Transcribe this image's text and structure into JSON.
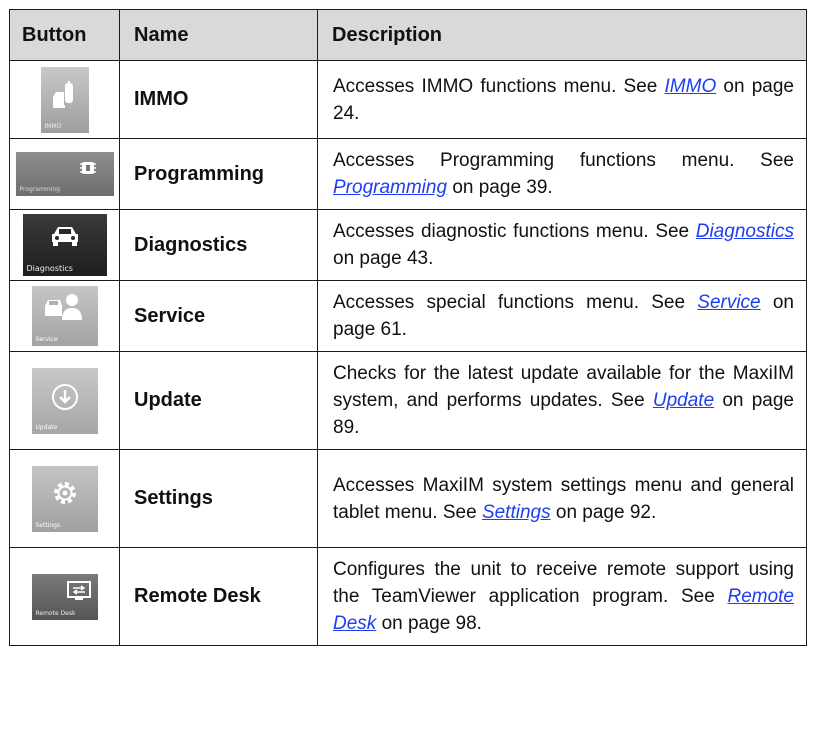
{
  "headers": {
    "button": "Button",
    "name": "Name",
    "description": "Description"
  },
  "rows": [
    {
      "name": "IMMO",
      "tile_caption": "IMMO",
      "icon": "car-key-fob-icon",
      "desc_pre": "Accesses IMMO functions menu. See ",
      "link": "IMMO",
      "desc_post": " on page 24."
    },
    {
      "name": "Programming",
      "tile_caption": "Programming",
      "icon": "chip-icon",
      "desc_pre": "Accesses Programming functions menu. See ",
      "link": "Programming",
      "desc_post": " on page 39."
    },
    {
      "name": "Diagnostics",
      "tile_caption": "Diagnostics",
      "icon": "car-front-icon",
      "desc_pre": "Accesses diagnostic functions menu. See ",
      "link": "Diagnostics",
      "desc_post": " on page 43."
    },
    {
      "name": "Service",
      "tile_caption": "Service",
      "icon": "car-mechanic-icon",
      "desc_pre": "Accesses special functions menu. See ",
      "link": "Service",
      "desc_post": " on page 61."
    },
    {
      "name": "Update",
      "tile_caption": "Update",
      "icon": "download-circle-icon",
      "desc_pre": "Checks for the latest update available for the MaxiIM system, and performs updates. See ",
      "link": "Update",
      "desc_post": " on page 89."
    },
    {
      "name": "Settings",
      "tile_caption": "Settings",
      "icon": "gear-icon",
      "desc_pre": "Accesses MaxiIM system settings menu and general tablet menu. See ",
      "link": "Settings",
      "desc_post": " on page 92."
    },
    {
      "name": "Remote Desk",
      "tile_caption": "Remote Desk",
      "icon": "remote-screen-icon",
      "desc_pre": "Configures the unit to receive remote support using the TeamViewer application program. See ",
      "link": "Remote Desk",
      "desc_post": " on page 98."
    }
  ],
  "colors": {
    "link": "#1f3df0",
    "header_bg": "#d9d9d9"
  }
}
